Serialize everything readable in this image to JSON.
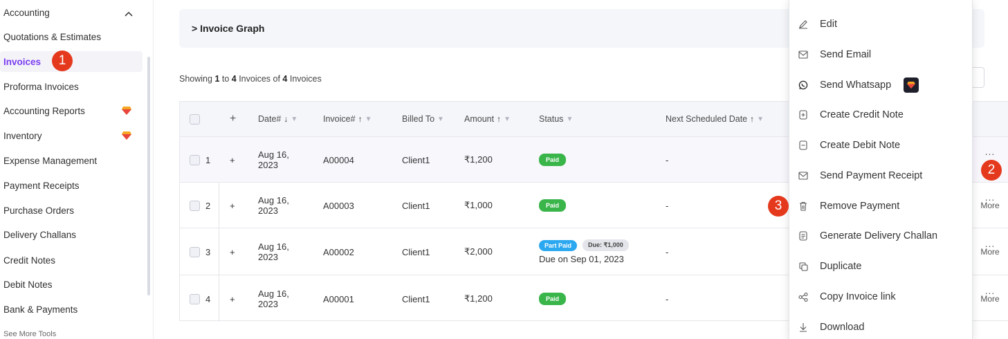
{
  "sidebar": {
    "header": "Accounting",
    "items": [
      {
        "label": "Quotations & Estimates"
      },
      {
        "label": "Invoices"
      },
      {
        "label": "Proforma Invoices"
      },
      {
        "label": "Accounting Reports"
      },
      {
        "label": "Inventory"
      },
      {
        "label": "Expense Management"
      },
      {
        "label": "Payment Receipts"
      },
      {
        "label": "Purchase Orders"
      },
      {
        "label": "Delivery Challans"
      },
      {
        "label": "Credit Notes"
      },
      {
        "label": "Debit Notes"
      },
      {
        "label": "Bank & Payments"
      }
    ],
    "see_more": "See More Tools"
  },
  "annotations": [
    "1",
    "2",
    "3"
  ],
  "graph_toggle": "> Invoice Graph",
  "showing": {
    "prefix": "Showing ",
    "from": "1",
    "to_word": " to ",
    "to": "4",
    "mid": " Invoices of ",
    "total": "4",
    "suffix": " Invoices"
  },
  "table": {
    "headers": {
      "date": "Date#",
      "invoice": "Invoice#",
      "billed_to": "Billed To",
      "amount": "Amount",
      "status": "Status",
      "next_scheduled": "Next Scheduled Date"
    },
    "rows": [
      {
        "num": "1",
        "date_line1": "Aug 16,",
        "date_line2": "2023",
        "invoice": "A00004",
        "billed_to": "Client1",
        "amount": "₹1,200",
        "status": "Paid",
        "next": "-",
        "more": ""
      },
      {
        "num": "2",
        "date_line1": "Aug 16,",
        "date_line2": "2023",
        "invoice": "A00003",
        "billed_to": "Client1",
        "amount": "₹1,000",
        "status": "Paid",
        "next": "-",
        "more": "More"
      },
      {
        "num": "3",
        "date_line1": "Aug 16,",
        "date_line2": "2023",
        "invoice": "A00002",
        "billed_to": "Client1",
        "amount": "₹2,000",
        "status": "Part Paid",
        "due_badge": "Due: ₹1,000",
        "due_on": "Due on Sep 01, 2023",
        "next": "-",
        "more": "More"
      },
      {
        "num": "4",
        "date_line1": "Aug 16,",
        "date_line2": "2023",
        "invoice": "A00001",
        "billed_to": "Client1",
        "amount": "₹1,200",
        "status": "Paid",
        "next": "-",
        "more": "More"
      }
    ]
  },
  "menu": {
    "items": [
      {
        "label": "Edit",
        "icon": "pencil-icon"
      },
      {
        "label": "Send Email",
        "icon": "mail-icon"
      },
      {
        "label": "Send Whatsapp",
        "icon": "whatsapp-icon"
      },
      {
        "label": "Create Credit Note",
        "icon": "plus-doc-icon"
      },
      {
        "label": "Create Debit Note",
        "icon": "minus-doc-icon"
      },
      {
        "label": "Send Payment Receipt",
        "icon": "mail-icon"
      },
      {
        "label": "Remove Payment",
        "icon": "trash-icon"
      },
      {
        "label": "Generate Delivery Challan",
        "icon": "doc-icon"
      },
      {
        "label": "Duplicate",
        "icon": "copy-icon"
      },
      {
        "label": "Copy Invoice link",
        "icon": "share-icon"
      },
      {
        "label": "Download",
        "icon": "download-icon"
      }
    ]
  },
  "colors": {
    "accent": "#7a3df0",
    "annotation": "#e5391d",
    "paid": "#39b54a",
    "part_paid": "#2ca8f0"
  }
}
